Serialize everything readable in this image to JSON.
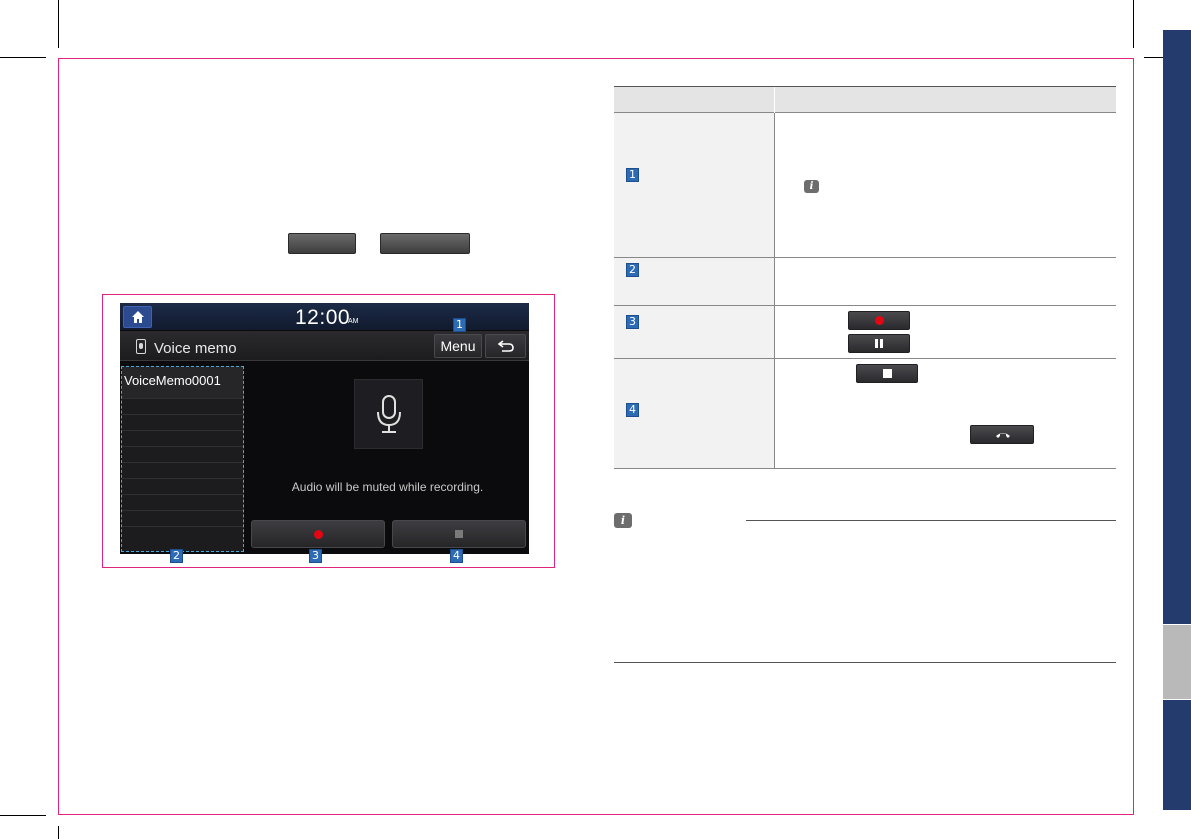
{
  "screen": {
    "clock": "12:00",
    "ampm": "AM",
    "title": "Voice memo",
    "menu_label": "Menu",
    "list_item": "VoiceMemo0001",
    "muted_message": "Audio will be muted while recording."
  },
  "callouts": {
    "menu": "1",
    "list": "2",
    "record": "3",
    "stop": "4"
  },
  "table": {
    "rows": [
      {
        "num": "1"
      },
      {
        "num": "2"
      },
      {
        "num": "3"
      },
      {
        "num": "4"
      }
    ]
  },
  "icons": {
    "home": "home-icon",
    "back": "back-arrow-icon",
    "memo": "voice-memo-icon",
    "mic": "microphone-icon",
    "record": "record-dot-icon",
    "pause": "pause-icon",
    "stop": "stop-square-icon",
    "end_call": "end-call-icon",
    "info": "info-icon"
  },
  "colors": {
    "frame_accent": "#e0237f",
    "side_tab_blue": "#243b6e",
    "side_tab_grey": "#b9b9b9",
    "callout_blue": "#2d6bb5",
    "record_red": "#e30613"
  },
  "info_glyph": "i"
}
